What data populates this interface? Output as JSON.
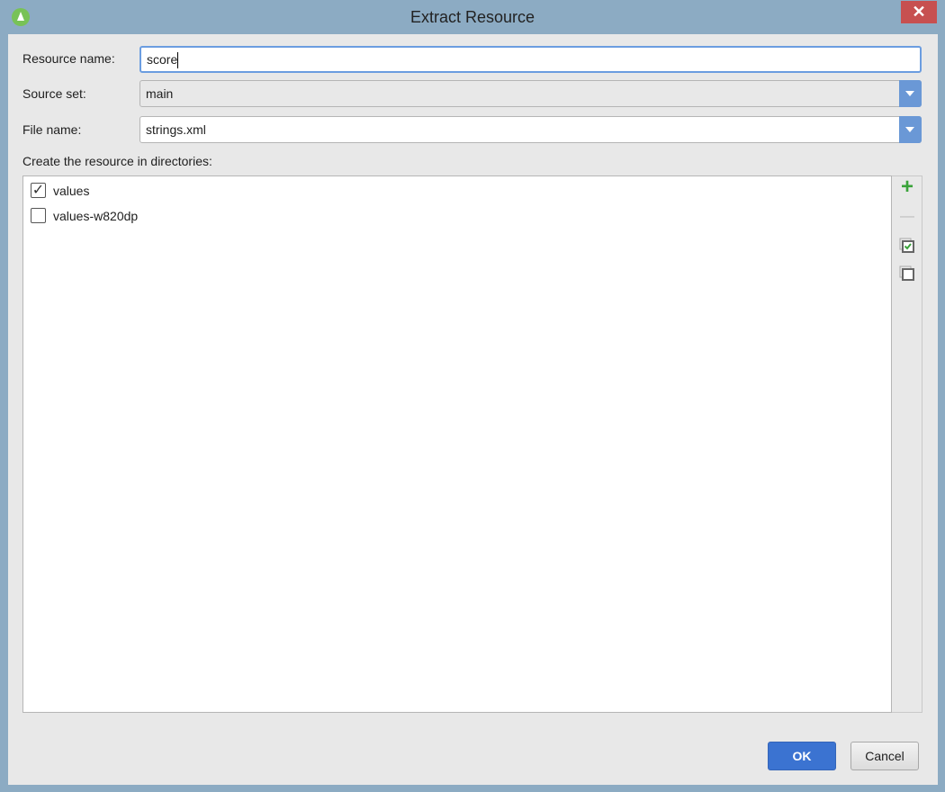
{
  "window": {
    "title": "Extract Resource",
    "close_symbol": "✕"
  },
  "form": {
    "resource_name_label": "Resource name:",
    "resource_name_value": "score",
    "source_set_label": "Source set:",
    "source_set_value": "main",
    "file_name_label": "File name:",
    "file_name_value": "strings.xml",
    "directories_label": "Create the resource in directories:"
  },
  "directories": [
    {
      "label": "values",
      "checked": true
    },
    {
      "label": "values-w820dp",
      "checked": false
    }
  ],
  "toolbar": {
    "add": "+",
    "remove": "—"
  },
  "buttons": {
    "ok": "OK",
    "cancel": "Cancel"
  },
  "colors": {
    "accent": "#3b73d1",
    "close": "#c75050",
    "frame": "#8cabc3"
  }
}
